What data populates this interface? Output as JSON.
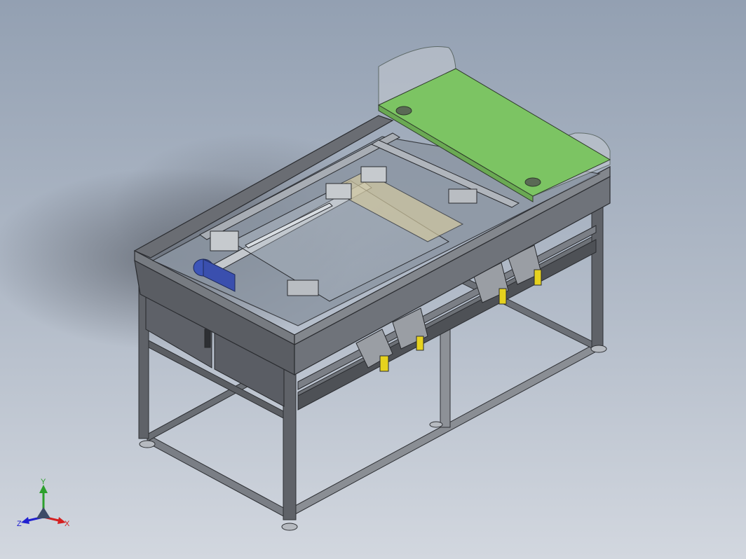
{
  "triad": {
    "y_label": "Y",
    "x_label": "X",
    "z_label": "Z"
  },
  "colors": {
    "background_top": "#93a0b2",
    "background_bottom": "#d2d7df",
    "frame": "#5b5e63",
    "frame_light": "#8a8e94",
    "panel": "#6c7077",
    "green_cover": "#7cc463",
    "motor": "#3d55b8",
    "yellow_tag": "#e6d21e",
    "axis_x": "#d42020",
    "axis_y": "#2ca02c",
    "axis_z": "#2020d0"
  }
}
